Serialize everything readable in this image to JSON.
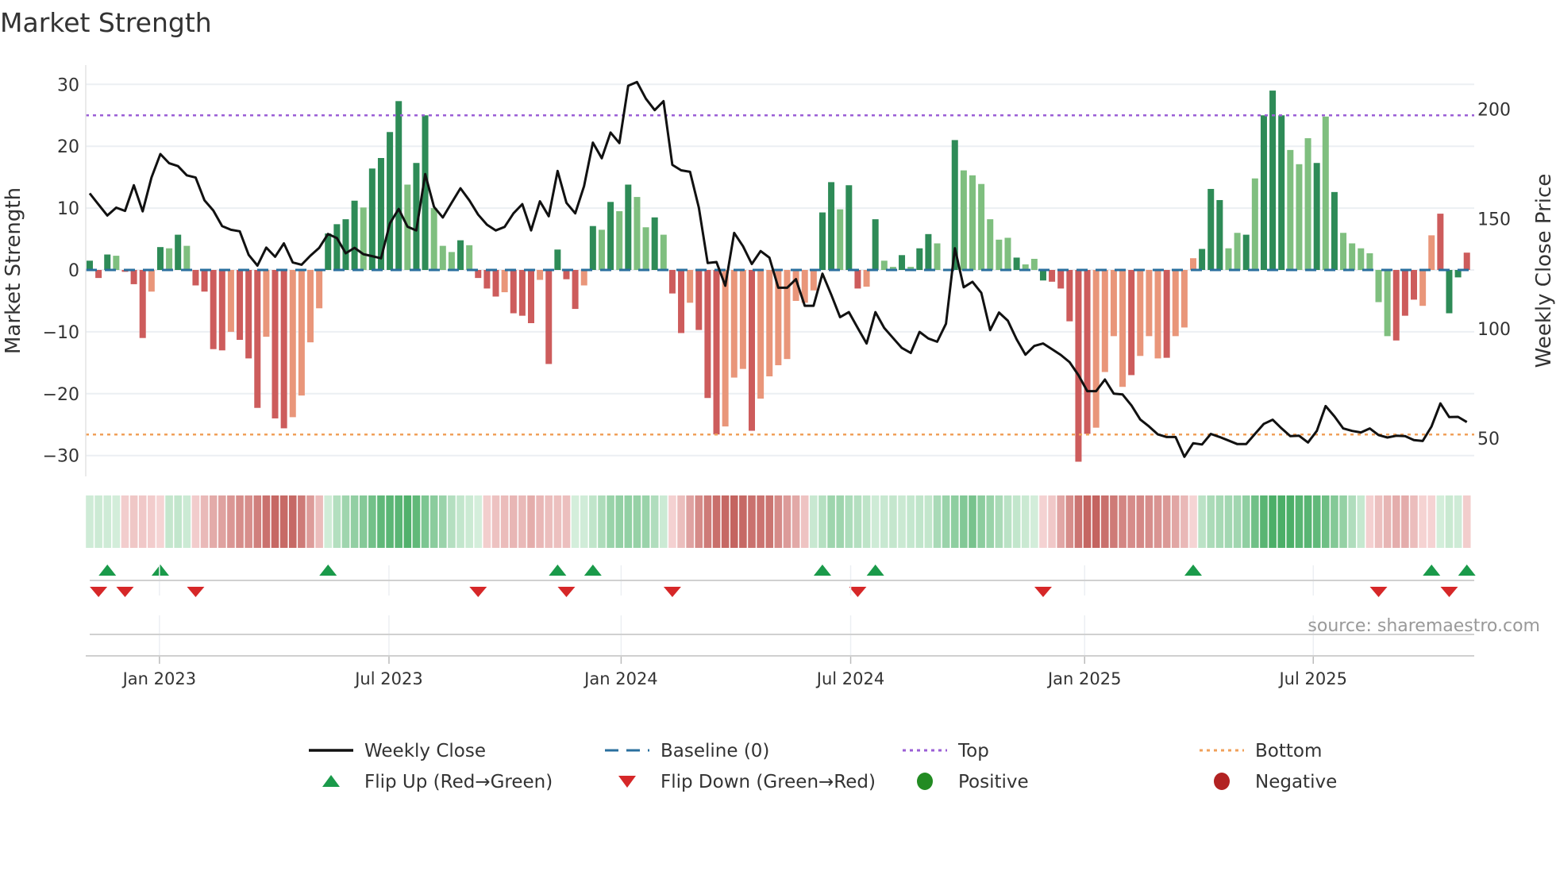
{
  "chart_data": {
    "type": "bar",
    "title": "Market Strength",
    "ylabel": "Market Strength",
    "y2label": "Weekly Close Price",
    "ylim": [
      -33.4,
      33.1
    ],
    "y2lim": [
      32.6,
      220
    ],
    "yticks": [
      30,
      20,
      10,
      0,
      -10,
      -20,
      -30
    ],
    "yticklabels": [
      "30",
      "20",
      "10",
      "0",
      "−10",
      "−20",
      "−30"
    ],
    "y2ticks": [
      200,
      150,
      100,
      50
    ],
    "y2ticklabels": [
      "200",
      "150",
      "100",
      "50"
    ],
    "xticks": [
      {
        "week": 7.9,
        "label": "Jan 2023"
      },
      {
        "week": 33.9,
        "label": "Jul 2023"
      },
      {
        "week": 60.2,
        "label": "Jan 2024"
      },
      {
        "week": 86.2,
        "label": "Jul 2024"
      },
      {
        "week": 112.7,
        "label": "Jan 2025"
      },
      {
        "week": 138.6,
        "label": "Jul 2025"
      }
    ],
    "grid": true,
    "strength": [
      1.5,
      -1.3,
      2.5,
      2.3,
      -0.3,
      -2.3,
      -11,
      -3.5,
      3.7,
      3.5,
      5.7,
      3.9,
      -2.5,
      -3.5,
      -12.8,
      -13,
      -10,
      -11.3,
      -14.3,
      -22.3,
      -10.8,
      -24,
      -25.6,
      -23.8,
      -20.3,
      -11.7,
      -6.2,
      5.9,
      7.4,
      8.2,
      11.2,
      10.1,
      16.4,
      18.1,
      22.3,
      27.3,
      13.8,
      17.3,
      25,
      10,
      3.9,
      2.9,
      4.8,
      4.0,
      -1.3,
      -3,
      -4.3,
      -3.6,
      -7,
      -7.4,
      -8.6,
      -1.6,
      -15.2,
      3.3,
      -1.5,
      -6.3,
      -2.5,
      7.1,
      6.5,
      11,
      9.5,
      13.8,
      11.8,
      6.9,
      8.5,
      5.7,
      -3.8,
      -10.2,
      -5.3,
      -9.7,
      -20.7,
      -26.6,
      -25.3,
      -17.4,
      -16,
      -26,
      -20.8,
      -17.2,
      -15.4,
      -14.4,
      -5,
      -5.3,
      -3.3,
      9.3,
      14.2,
      9.8,
      13.7,
      -3,
      -2.7,
      8.2,
      1.5,
      0.5,
      2.4,
      0.5,
      3.5,
      5.8,
      4.3,
      0,
      21,
      16.1,
      15.3,
      13.9,
      8.2,
      4.9,
      5.2,
      2,
      0.9,
      1.8,
      -1.7,
      -1.9,
      -3,
      -8.3,
      -31,
      -26.5,
      -25.5,
      -16.5,
      -10.7,
      -18.9,
      -17,
      -13.9,
      -10.7,
      -14.3,
      -14.2,
      -10.7,
      -9.3,
      1.9,
      3.4,
      13.1,
      11.3,
      3.5,
      6,
      5.7,
      14.8,
      25,
      29,
      25,
      19.4,
      17.1,
      21.3,
      17.3,
      24.8,
      12.6,
      6,
      4.3,
      3.5,
      2.7,
      -5.2,
      -10.7,
      -11.4,
      -7.4,
      -4.8,
      -5.8,
      5.6,
      9.1,
      -7,
      -1.2,
      2.8
    ],
    "shade": "GRGgRRRrGgGgRRRRrRRRrRRrrrrGGGGgGGGGgGGgggGgRRRrRRRrRGRRrGgGgGggGgRRrRRRrrrRrrrrrrrGGgGRrGggGgGGggGggggggGggGRRRRRrrrrRrrrRrrrGGGggGgGGGgggGgGggggggRRRrrRGGRrG",
    "weekly_close": [
      161.6,
      156.5,
      151.5,
      155.1,
      153.6,
      165.3,
      153.4,
      168.8,
      179.5,
      175.3,
      174.0,
      169.8,
      168.8,
      158.4,
      153.8,
      146.7,
      145,
      144.3,
      133.6,
      128.7,
      136.9,
      132.7,
      138.8,
      130.1,
      129.1,
      133.2,
      136.8,
      143.1,
      141.2,
      134.3,
      136.8,
      133.9,
      133,
      132,
      147.9,
      154.5,
      146.4,
      144.7,
      170.4,
      155.4,
      150.6,
      157.3,
      163.9,
      158.4,
      151.9,
      147.3,
      144.7,
      146.3,
      152.5,
      156.7,
      144.7,
      158,
      151.2,
      171.8,
      157.3,
      152.5,
      164.9,
      184.7,
      177.6,
      189.3,
      184.5,
      210.6,
      212.3,
      204.7,
      199.5,
      203.6,
      174.6,
      172.1,
      171.4,
      155.1,
      129.9,
      130.3,
      119.5,
      143.6,
      137.5,
      129.4,
      135.3,
      132.3,
      118.6,
      118.6,
      122.5,
      110.4,
      110.4,
      125,
      115.4,
      105.2,
      107.5,
      100.3,
      93.2,
      107.5,
      100.3,
      95.7,
      91.2,
      88.9,
      98.5,
      95.5,
      94,
      102.2,
      136.6,
      118.8,
      121.3,
      116.3,
      99.3,
      107.3,
      103.6,
      95.1,
      88.1,
      92.1,
      93.2,
      90.6,
      88,
      84.7,
      78.8,
      71.5,
      71.5,
      76.8,
      70.4,
      70,
      65,
      58.6,
      55.4,
      51.8,
      50.6,
      50.6,
      41.6,
      47.8,
      47.2,
      52,
      50.6,
      49,
      47.4,
      47.4,
      52,
      56.6,
      58.5,
      54.6,
      51,
      51.2,
      48.1,
      53.4,
      64.7,
      60,
      54.5,
      53.4,
      52.7,
      54.5,
      51.5,
      50.4,
      51.2,
      51,
      49.2,
      48.8,
      55.4,
      65.9,
      59.7,
      59.8,
      57.4
    ],
    "top_level": 25,
    "bottom_level": -26.6,
    "baseline": 0,
    "flip_up_weeks": [
      2,
      8,
      27,
      53,
      57,
      83,
      89,
      125,
      152,
      156
    ],
    "flip_down_weeks": [
      1,
      4,
      12,
      44,
      54,
      66,
      87,
      108,
      146,
      154
    ],
    "legend": {
      "placement": "bottom",
      "entries": [
        {
          "label": "Weekly Close",
          "kind": "line"
        },
        {
          "label": "Baseline (0)",
          "kind": "dash"
        },
        {
          "label": "Top",
          "kind": "dot-top"
        },
        {
          "label": "Bottom",
          "kind": "dot-bottom"
        },
        {
          "label": "Flip Up (Red→Green)",
          "kind": "tri-up"
        },
        {
          "label": "Flip Down (Green→Red)",
          "kind": "tri-down"
        },
        {
          "label": "Positive",
          "kind": "dot-pos"
        },
        {
          "label": "Negative",
          "kind": "dot-neg"
        }
      ]
    },
    "source": "source: sharemaestro.com"
  },
  "colors": {
    "pos_dark": "#2e8b57",
    "pos_light": "#7fbf7f",
    "neg_dark": "#cd5c5c",
    "neg_light": "#e9967a",
    "line": "#111111",
    "baseline": "#2a6f9e",
    "top": "#9b5fd6",
    "bottom": "#f0a05a",
    "flip_up": "#1a9a4a",
    "flip_down": "#d62728",
    "positive": "#228b22",
    "negative": "#b22222"
  }
}
